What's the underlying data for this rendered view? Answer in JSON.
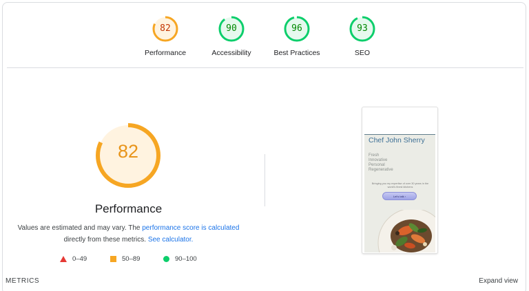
{
  "scores": [
    {
      "value": "82",
      "label": "Performance",
      "score": 82,
      "color": "#f6a623",
      "text_color": "#c33300",
      "fill": "#fff3e0"
    },
    {
      "value": "90",
      "label": "Accessibility",
      "score": 90,
      "color": "#0cce6b",
      "text_color": "#008800",
      "fill": "#e6f9ee"
    },
    {
      "value": "96",
      "label": "Best Practices",
      "score": 96,
      "color": "#0cce6b",
      "text_color": "#008800",
      "fill": "#e6f9ee"
    },
    {
      "value": "93",
      "label": "SEO",
      "score": 93,
      "color": "#0cce6b",
      "text_color": "#008800",
      "fill": "#e6f9ee"
    }
  ],
  "main": {
    "score_value": "82",
    "score": 82,
    "title": "Performance",
    "desc_1": "Values are estimated and may vary. The ",
    "desc_link_1": "performance score is calculated",
    "desc_2": "directly from these metrics. ",
    "desc_link_2": "See calculator."
  },
  "legend": [
    {
      "range": "0–49",
      "icon": "triangle-icon",
      "color": "#e53935"
    },
    {
      "range": "50–89",
      "icon": "square-icon",
      "color": "#f6a623"
    },
    {
      "range": "90–100",
      "icon": "circle-icon",
      "color": "#0cce6b"
    }
  ],
  "preview": {
    "title": "Chef John Sherry",
    "list": [
      "Fresh",
      "Innovative",
      "Personal",
      "Regenerative"
    ],
    "subtitle": "Bringing you my expertise of over 30 years in the world's finest kitchens",
    "button": "Let's talk"
  },
  "footer": {
    "metrics_label": "METRICS",
    "expand_label": "Expand view"
  }
}
